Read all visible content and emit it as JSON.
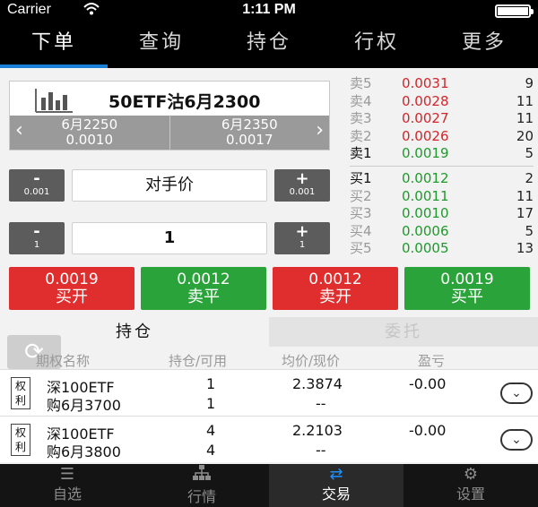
{
  "status_bar": {
    "carrier": "Carrier",
    "time": "1:11 PM"
  },
  "top_tabs": [
    "下单",
    "查询",
    "持仓",
    "行权",
    "更多"
  ],
  "contract": {
    "name": "50ETF沽6月2300",
    "prev": {
      "name": "6月2250",
      "price": "0.0010"
    },
    "next": {
      "name": "6月2350",
      "price": "0.0017"
    }
  },
  "price_stepper": {
    "minus": "-",
    "plus": "+",
    "step": "0.001",
    "value": "对手价"
  },
  "qty_stepper": {
    "minus": "-",
    "plus": "+",
    "step": "1",
    "value": "1"
  },
  "order_buttons": [
    {
      "price": "0.0019",
      "label": "买开",
      "color": "#e02d2d"
    },
    {
      "price": "0.0012",
      "label": "卖平",
      "color": "#2aa43a"
    },
    {
      "price": "0.0012",
      "label": "卖开",
      "color": "#e02d2d"
    },
    {
      "price": "0.0019",
      "label": "买平",
      "color": "#2aa43a"
    }
  ],
  "asks": [
    {
      "label": "卖5",
      "price": "0.0031",
      "vol": "9"
    },
    {
      "label": "卖4",
      "price": "0.0028",
      "vol": "11"
    },
    {
      "label": "卖3",
      "price": "0.0027",
      "vol": "11"
    },
    {
      "label": "卖2",
      "price": "0.0026",
      "vol": "20"
    },
    {
      "label": "卖1",
      "price": "0.0019",
      "vol": "5"
    }
  ],
  "bids": [
    {
      "label": "买1",
      "price": "0.0012",
      "vol": "2"
    },
    {
      "label": "买2",
      "price": "0.0011",
      "vol": "11"
    },
    {
      "label": "买3",
      "price": "0.0010",
      "vol": "17"
    },
    {
      "label": "买4",
      "price": "0.0006",
      "vol": "5"
    },
    {
      "label": "买5",
      "price": "0.0005",
      "vol": "13"
    }
  ],
  "positions_tabs": {
    "active": "持仓",
    "inactive": "委托"
  },
  "positions_header": [
    "期权名称",
    "持仓/可用",
    "均价/现价",
    "盈亏"
  ],
  "positions": [
    {
      "badge": [
        "权",
        "利"
      ],
      "name1": "深100ETF",
      "name2": "购6月3700",
      "hold": "1",
      "avail": "1",
      "avg": "2.3874",
      "cur": "--",
      "pnl": "-0.00"
    },
    {
      "badge": [
        "权",
        "利"
      ],
      "name1": "深100ETF",
      "name2": "购6月3800",
      "hold": "4",
      "avail": "4",
      "avg": "2.2103",
      "cur": "--",
      "pnl": "-0.00"
    }
  ],
  "bottom_tabs": [
    {
      "label": "自选",
      "icon": "list-icon"
    },
    {
      "label": "行情",
      "icon": "hierarchy-icon"
    },
    {
      "label": "交易",
      "icon": "swap-arrows-icon"
    },
    {
      "label": "设置",
      "icon": "gears-icon"
    }
  ],
  "colors": {
    "accent": "#1a7fd6",
    "up": "#d0262b",
    "down": "#1d9a2b"
  }
}
